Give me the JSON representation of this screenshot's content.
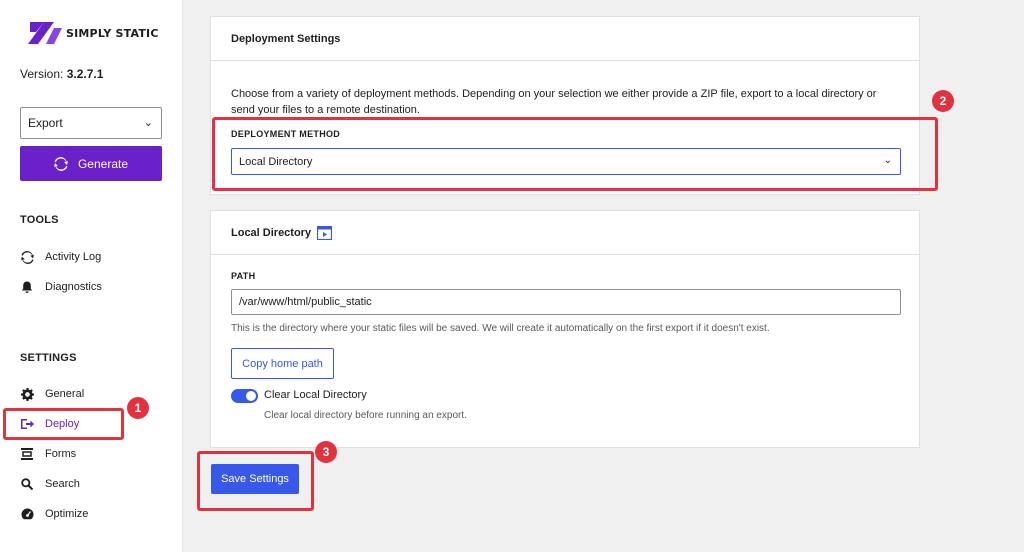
{
  "brand": {
    "name": "SIMPLY STATIC",
    "accent": "#6b21c9",
    "primary": "#3858e9",
    "highlight": "#e0323f"
  },
  "sidebar": {
    "version_label": "Version:",
    "version_value": "3.2.7.1",
    "export_select": {
      "value": "Export"
    },
    "generate_label": "Generate",
    "tools_title": "TOOLS",
    "tools": [
      {
        "label": "Activity Log",
        "icon": "refresh-icon"
      },
      {
        "label": "Diagnostics",
        "icon": "bell-icon"
      }
    ],
    "settings_title": "SETTINGS",
    "settings": [
      {
        "label": "General",
        "icon": "gear-icon"
      },
      {
        "label": "Deploy",
        "icon": "deploy-icon",
        "active": true
      },
      {
        "label": "Forms",
        "icon": "forms-icon"
      },
      {
        "label": "Search",
        "icon": "search-icon"
      },
      {
        "label": "Optimize",
        "icon": "gauge-icon"
      }
    ]
  },
  "deployment_card": {
    "title": "Deployment Settings",
    "description": "Choose from a variety of deployment methods. Depending on your selection we either provide a ZIP file, export to a local directory or send your files to a remote destination.",
    "method_label": "DEPLOYMENT METHOD",
    "method_value": "Local Directory"
  },
  "local_card": {
    "title": "Local Directory",
    "path_label": "PATH",
    "path_value": "/var/www/html/public_static",
    "path_help": "This is the directory where your static files will be saved. We will create it automatically on the first export if it doesn't exist.",
    "copy_button": "Copy home path",
    "toggle_label": "Clear Local Directory",
    "toggle_on": true,
    "toggle_help": "Clear local directory before running an export."
  },
  "save_button": "Save Settings",
  "annotations": [
    "1",
    "2",
    "3"
  ]
}
